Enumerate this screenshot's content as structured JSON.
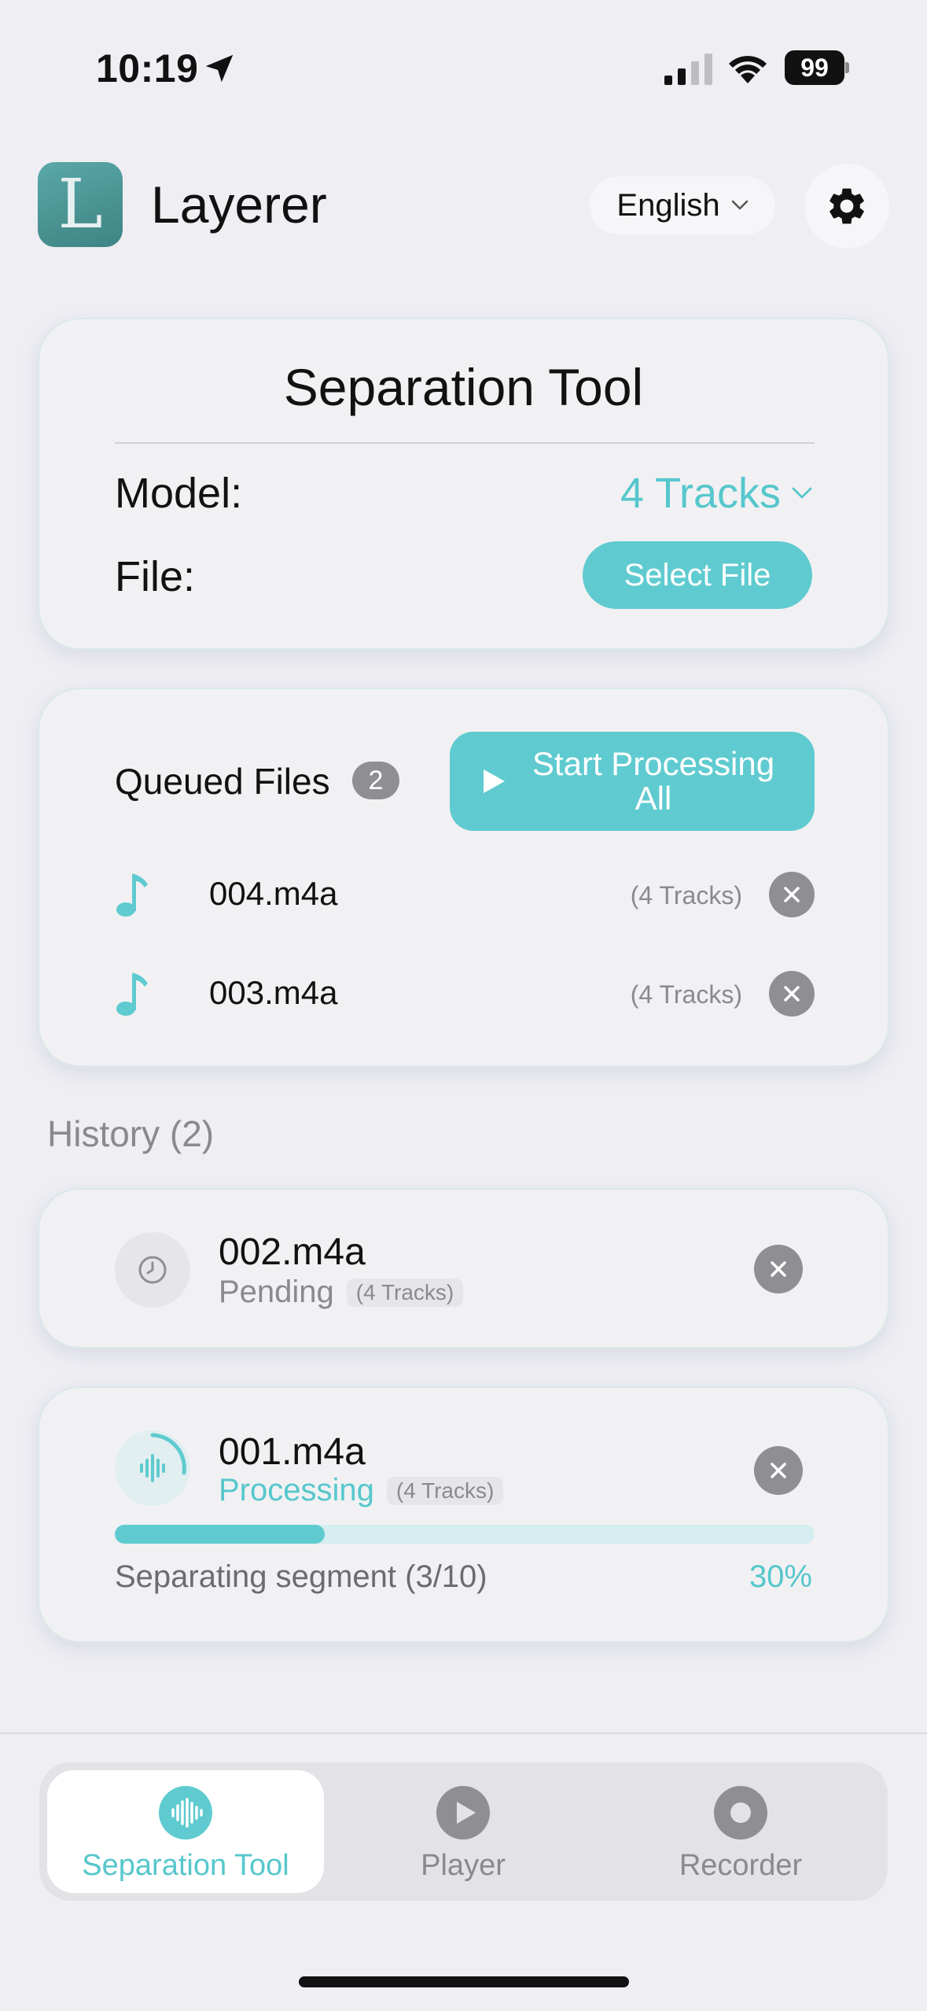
{
  "status_bar": {
    "time": "10:19",
    "battery": "99"
  },
  "header": {
    "app_title": "Layerer",
    "logo_letter": "L",
    "language": "English"
  },
  "tool_card": {
    "title": "Separation Tool",
    "model_label": "Model:",
    "model_value": "4 Tracks",
    "file_label": "File:",
    "select_file_label": "Select File"
  },
  "queue": {
    "label": "Queued Files",
    "count": "2",
    "start_label": "Start Processing All",
    "items": [
      {
        "name": "004.m4a",
        "tracks": "(4 Tracks)"
      },
      {
        "name": "003.m4a",
        "tracks": "(4 Tracks)"
      }
    ]
  },
  "history": {
    "title": "History (2)",
    "items": [
      {
        "name": "002.m4a",
        "status": "Pending",
        "tracks": "(4 Tracks)"
      },
      {
        "name": "001.m4a",
        "status": "Processing",
        "tracks": "(4 Tracks)",
        "progress_label": "Separating segment (3/10)",
        "progress_pct": "30%",
        "progress": 0.3
      }
    ]
  },
  "tabs": [
    {
      "label": "Separation Tool",
      "icon": "waveform-icon",
      "active": true
    },
    {
      "label": "Player",
      "icon": "play-circle-icon",
      "active": false
    },
    {
      "label": "Recorder",
      "icon": "record-circle-icon",
      "active": false
    }
  ],
  "colors": {
    "accent": "#5fcbd0",
    "accent_text": "#56c7cc",
    "gray": "#8e8e93",
    "background": "#eeeef3"
  }
}
